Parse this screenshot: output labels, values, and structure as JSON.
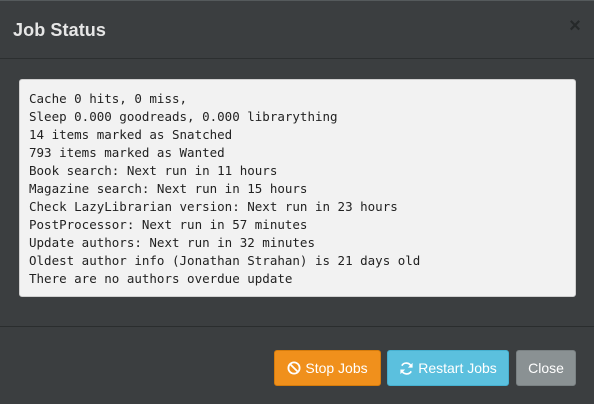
{
  "modal": {
    "title": "Job Status",
    "close_glyph": "×"
  },
  "status_lines": [
    "Cache 0 hits, 0 miss,",
    "Sleep 0.000 goodreads, 0.000 librarything",
    "14 items marked as Snatched",
    "793 items marked as Wanted",
    "Book search: Next run in 11 hours",
    "Magazine search: Next run in 15 hours",
    "Check LazyLibrarian version: Next run in 23 hours",
    "PostProcessor: Next run in 57 minutes",
    "Update authors: Next run in 32 minutes",
    "Oldest author info (Jonathan Strahan) is 21 days old",
    "There are no authors overdue update"
  ],
  "buttons": {
    "stop": {
      "label": "Stop Jobs",
      "icon": "ban-icon",
      "color": "#f0901c"
    },
    "restart": {
      "label": "Restart Jobs",
      "icon": "refresh-icon",
      "color": "#5bc0de"
    },
    "close": {
      "label": "Close",
      "color": "#8a9193"
    }
  }
}
